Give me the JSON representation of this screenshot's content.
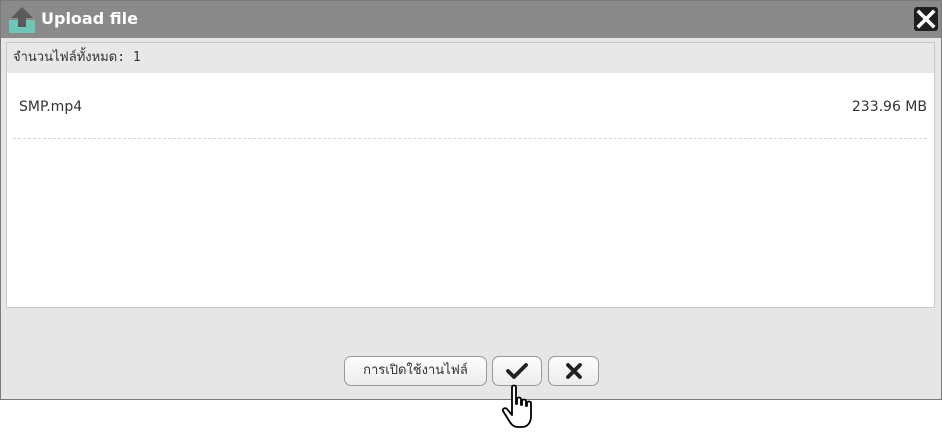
{
  "dialog": {
    "title": "Upload file",
    "title_icon": "upload-icon",
    "close_icon": "close-icon"
  },
  "summary": {
    "label": "จำนวนไฟล์ทั้งหมด: 1"
  },
  "files": [
    {
      "name": "SMP.mp4",
      "size": "233.96 MB"
    }
  ],
  "buttons": {
    "enable_label": "การเปิดใช้งานไฟล์",
    "confirm_icon": "checkmark-icon",
    "cancel_icon": "cross-icon"
  },
  "pointer": "hand-cursor-icon",
  "colors": {
    "titlebar": "#8a8a8a",
    "icon_teal": "#6fc6b7",
    "icon_arrow": "#5a5a5a",
    "close_bg": "#1e1e1e"
  }
}
